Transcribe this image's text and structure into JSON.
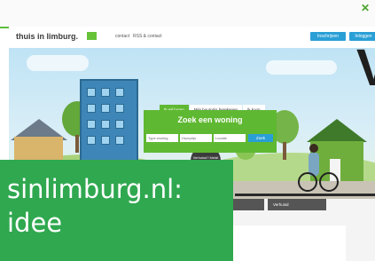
{
  "window": {
    "close_glyph": "✕"
  },
  "header": {
    "logo_text": "thuis in limburg.",
    "nav": [
      "contact",
      "RSS & contact"
    ],
    "register_label": "Inschrijven",
    "login_label": "Inloggen"
  },
  "search": {
    "tabs": [
      "Ik wil huren",
      "Mijn huurprijs berekenen",
      "Ik koop"
    ],
    "title": "Zoek een woning",
    "fields": [
      "Type woning",
      "Huurprijs",
      "Locatie"
    ],
    "submit_label": "Zoek"
  },
  "hero": {
    "sign_text": "Verhuisd? Meldt"
  },
  "bottom": {
    "buttons": [
      "",
      "Verhuisd"
    ]
  },
  "overlay": {
    "line1": "sinlimburg.nl:",
    "line2": "idee"
  },
  "colors": {
    "brand_green": "#5fb832",
    "overlay_green": "#2fa84f",
    "button_blue": "#2a9fd6"
  }
}
